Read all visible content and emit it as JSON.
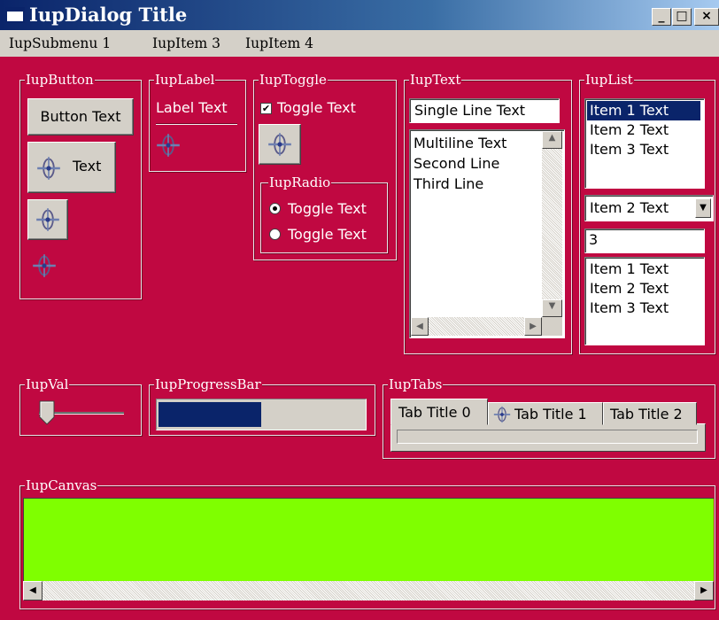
{
  "window": {
    "title": "IupDialog Title"
  },
  "caption_buttons": {
    "minimize": "_",
    "maximize": "□",
    "close": "×"
  },
  "menu": {
    "items": [
      "IupSubmenu 1",
      "IupItem 3",
      "IupItem 4"
    ]
  },
  "button_group": {
    "title": "IupButton",
    "button_text": "Button Text",
    "image_text_button": "Text"
  },
  "label_group": {
    "title": "IupLabel",
    "label": "Label Text"
  },
  "toggle_group": {
    "title": "IupToggle",
    "toggle_label": "Toggle Text",
    "toggle_checked": true
  },
  "radio_group": {
    "title": "IupRadio",
    "options": [
      "Toggle Text",
      "Toggle Text"
    ],
    "selected_index": 0
  },
  "text_group": {
    "title": "IupText",
    "single_line": "Single Line Text",
    "multiline": [
      "Multiline Text",
      "Second Line",
      "Third Line"
    ]
  },
  "list_group": {
    "title": "IupList",
    "list1": [
      "Item 1 Text",
      "Item 2 Text",
      "Item 3 Text"
    ],
    "list1_selected": 0,
    "dropdown_value": "Item 2 Text",
    "edit_value": "3",
    "list3": [
      "Item 1 Text",
      "Item 2 Text",
      "Item 3 Text"
    ]
  },
  "val_group": {
    "title": "IupVal",
    "value_fraction": 0.0
  },
  "progress_group": {
    "title": "IupProgressBar",
    "value_fraction": 0.5
  },
  "tabs_group": {
    "title": "IupTabs",
    "tabs": [
      "Tab Title 0",
      "Tab Title 1",
      "Tab Title 2"
    ],
    "active_tab": 0
  },
  "canvas_group": {
    "title": "IupCanvas",
    "canvas_color": "#7fff00"
  },
  "colors": {
    "dialog_background": "#c00841",
    "title_bar": "#0a246a",
    "selection": "#0a246a"
  }
}
